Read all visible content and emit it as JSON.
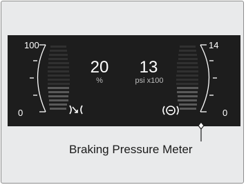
{
  "meters": {
    "left": {
      "max_label": "100",
      "min_label": "0",
      "value": "20",
      "unit": "%",
      "icon": "regen-brake-icon"
    },
    "right": {
      "max_label": "14",
      "min_label": "0",
      "value": "13",
      "unit": "psi x100",
      "icon": "brake-icon"
    }
  },
  "caption": "Braking Pressure Meter",
  "colors": {
    "screen": "#1d1d1d",
    "frame": "#e9eaeb",
    "scale_line": "#ffffff",
    "bar_lit": "#5a5a5a",
    "bar_dim": "#303030"
  }
}
